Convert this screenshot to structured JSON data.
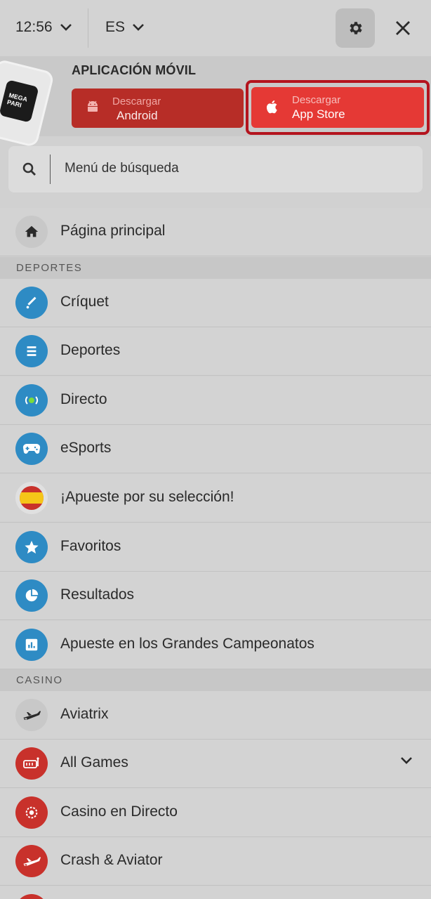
{
  "topbar": {
    "time": "12:56",
    "language": "ES"
  },
  "banner": {
    "title": "APLICACIÓN MÓVIL",
    "logo_text_1": "MEGA",
    "logo_text_2": "PARI",
    "android": {
      "small": "Descargar",
      "big": "Android"
    },
    "apple": {
      "small": "Descargar",
      "big": "App Store"
    }
  },
  "search": {
    "placeholder": "Menú de búsqueda"
  },
  "menu": {
    "home": "Página principal",
    "sports_header": "DEPORTES",
    "sports": [
      {
        "label": "Críquet",
        "icon": "cricket-icon"
      },
      {
        "label": "Deportes",
        "icon": "sports-list-icon"
      },
      {
        "label": "Directo",
        "icon": "live-icon"
      },
      {
        "label": "eSports",
        "icon": "gamepad-icon"
      },
      {
        "label": "¡Apueste por su selección!",
        "icon": "spain-flag-icon"
      },
      {
        "label": "Favoritos",
        "icon": "star-icon"
      },
      {
        "label": "Resultados",
        "icon": "pie-chart-icon"
      },
      {
        "label": "Apueste en los Grandes Campeonatos",
        "icon": "bar-chart-icon"
      }
    ],
    "casino_header": "CASINO",
    "casino": [
      {
        "label": "Aviatrix",
        "icon": "plane-icon"
      },
      {
        "label": "All Games",
        "icon": "slot-machine-icon"
      },
      {
        "label": "Casino en Directo",
        "icon": "chip-icon"
      },
      {
        "label": "Crash & Aviator",
        "icon": "plane-icon"
      }
    ]
  },
  "colors": {
    "accent_red": "#e53935",
    "dark_red": "#b72d27",
    "icon_blue": "#2e8bc4",
    "background": "#d1d1d1"
  }
}
